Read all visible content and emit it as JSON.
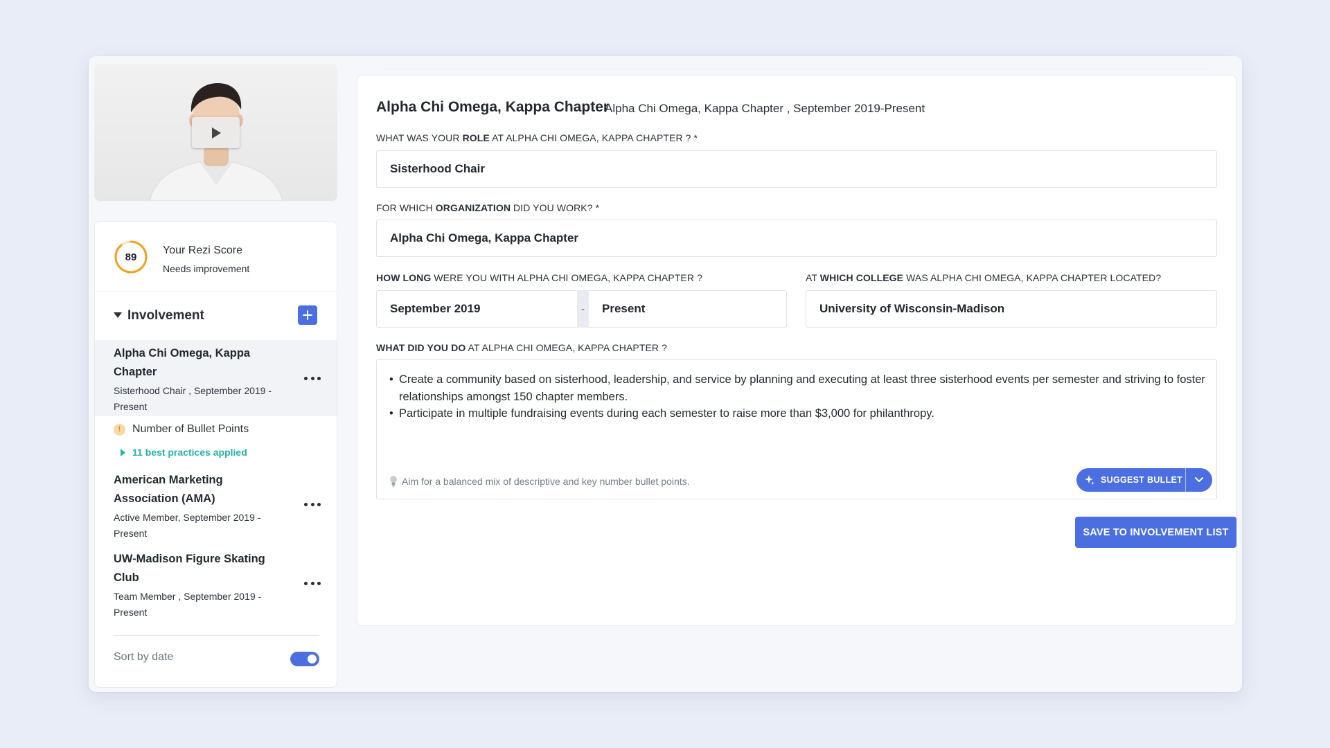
{
  "sidebar": {
    "score": {
      "value": "89",
      "fraction": 0.89,
      "title": "Your Rezi Score",
      "status": "Needs improvement",
      "ring_color": "#f0a21e"
    },
    "section": {
      "title": "Involvement",
      "add_label": "+"
    },
    "entries": [
      {
        "title": "Alpha Chi Omega, Kappa Chapter",
        "subtitle": "Sisterhood Chair , September 2019 - Present"
      },
      {
        "title": "American Marketing Association (AMA)",
        "subtitle": "Active Member, September 2019 - Present"
      },
      {
        "title": "UW-Madison Figure Skating Club",
        "subtitle": "Team Member , September 2019 - Present"
      }
    ],
    "feedback": {
      "warning_icon": "!",
      "warning": "Number of Bullet Points",
      "best_practices": "11 best practices applied"
    },
    "sort": {
      "label": "Sort by date",
      "enabled": true
    }
  },
  "form": {
    "header": {
      "title": "Alpha Chi Omega, Kappa Chapter",
      "subtitle": "Alpha Chi Omega, Kappa Chapter , September 2019-Present"
    },
    "role": {
      "label_pre": "WHAT WAS YOUR ",
      "label_bold": "ROLE",
      "label_post": " AT ALPHA CHI OMEGA, KAPPA CHAPTER ? *",
      "value": "Sisterhood Chair"
    },
    "organization": {
      "label_pre": "FOR WHICH ",
      "label_bold": "ORGANIZATION",
      "label_post": " DID YOU WORK? *",
      "value": "Alpha Chi Omega, Kappa Chapter"
    },
    "duration": {
      "label_bold": "HOW LONG",
      "label_post": " WERE YOU WITH ALPHA CHI OMEGA, KAPPA CHAPTER ?",
      "start": "September 2019",
      "separator": "-",
      "end": "Present"
    },
    "college": {
      "label_pre": "AT ",
      "label_bold": "WHICH COLLEGE",
      "label_post": " WAS ALPHA CHI OMEGA, KAPPA CHAPTER LOCATED?",
      "value": "University of Wisconsin-Madison"
    },
    "description": {
      "label_bold": "WHAT DID YOU DO",
      "label_post": " AT ALPHA CHI OMEGA, KAPPA CHAPTER ?",
      "bullets": [
        "Create a community based on sisterhood, leadership, and service by planning and executing at least three sisterhood events per semester and striving to foster relationships amongst 150 chapter members.",
        "Participate in multiple fundraising events during each semester to raise more than $3,000 for philanthropy."
      ],
      "hint": "Aim for a balanced mix of descriptive and key number bullet points.",
      "suggest_label": "SUGGEST BULLET"
    },
    "save_label": "SAVE TO INVOLVEMENT LIST"
  },
  "colors": {
    "accent": "#4b6fe0",
    "teal": "#27b3a4",
    "warning": "#f0a21e"
  },
  "icons": [
    "play-icon",
    "caret-down-icon",
    "plus-icon",
    "more-icon",
    "warning-icon",
    "caret-right-icon",
    "lightbulb-icon",
    "sparkle-icon",
    "chevron-down-icon"
  ]
}
